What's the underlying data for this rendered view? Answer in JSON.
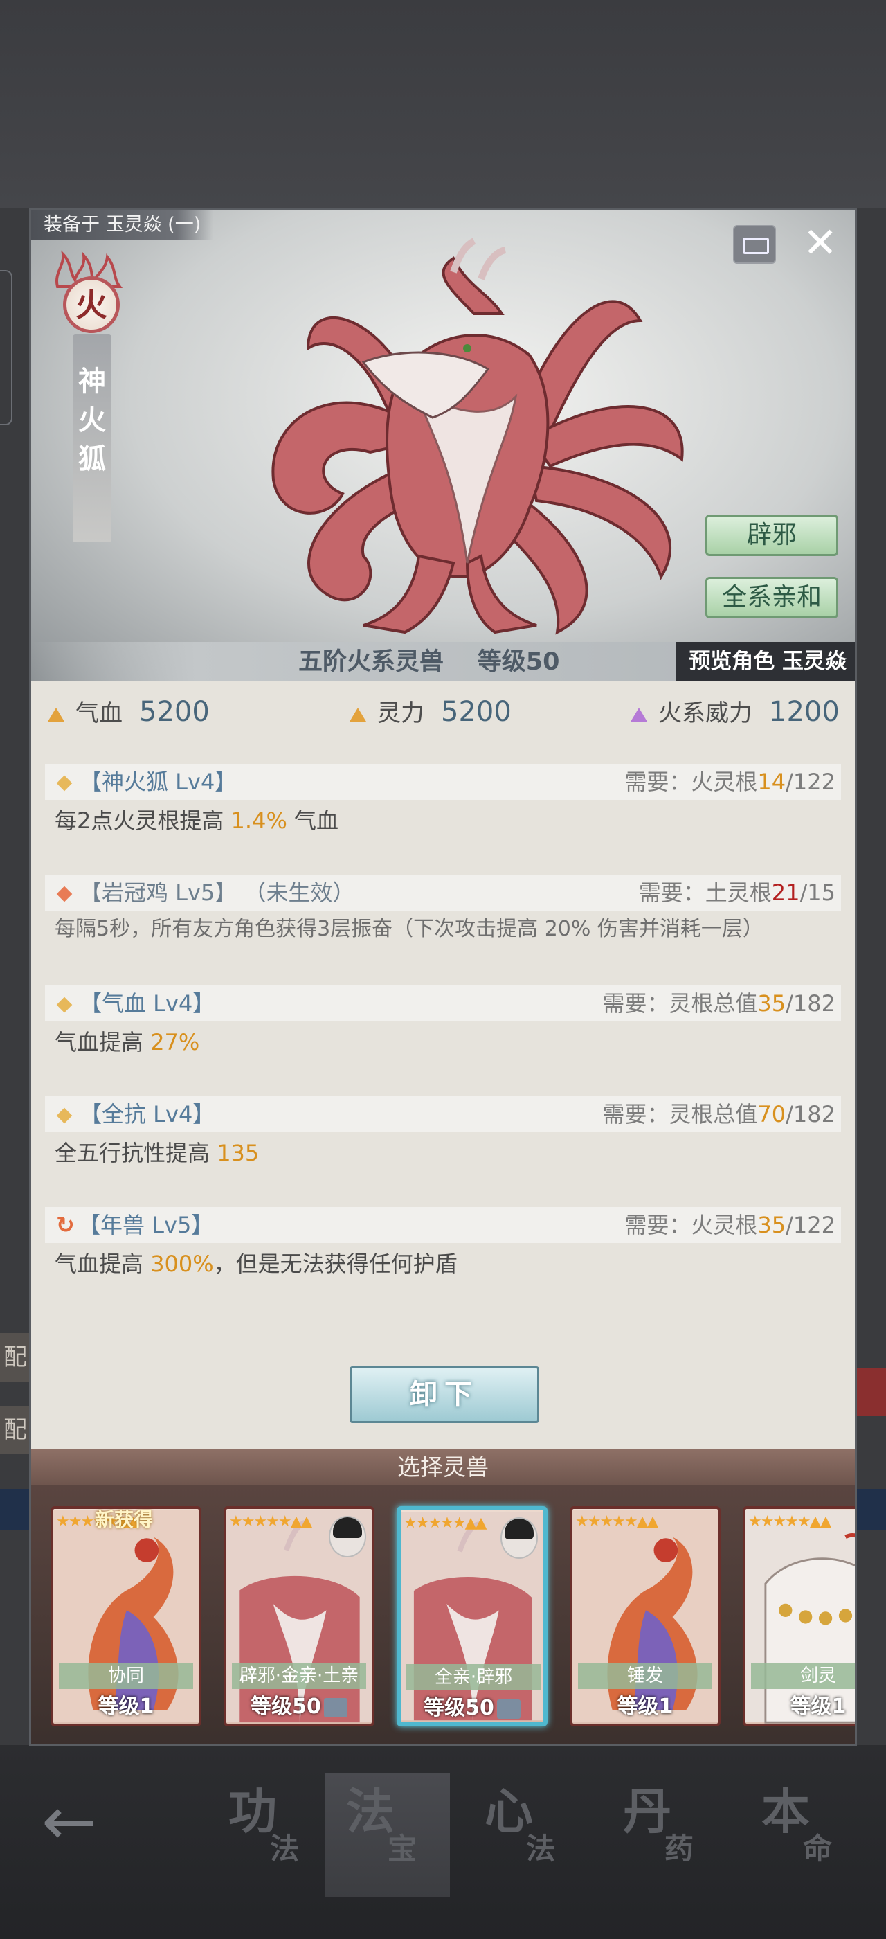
{
  "window": {
    "equipped_on": "装备于 玉灵焱 (一)"
  },
  "beast": {
    "element_badge": "火",
    "name": "神火狐",
    "tags": [
      "辟邪",
      "全系亲和"
    ],
    "tier_text": "五阶火系灵兽",
    "level_text": "等级50",
    "preview": "预览角色 玉灵焱"
  },
  "stats": [
    {
      "label": "气血",
      "value": "5200"
    },
    {
      "label": "灵力",
      "value": "5200"
    },
    {
      "label": "火系威力",
      "value": "1200"
    }
  ],
  "skills": [
    {
      "title": "【神火狐 Lv4】",
      "status": "",
      "req_label": "需要：火灵根",
      "req_have": "14",
      "req_total": "/122",
      "desc_a": "每2点火灵根提高 ",
      "desc_hl": "1.4%",
      "desc_b": " 气血"
    },
    {
      "title": "【岩冠鸡 Lv5】",
      "status": "（未生效）",
      "req_label": "需要：土灵根",
      "req_have": "21",
      "req_total": "/15",
      "desc_a": "每隔5秒，所有友方角色获得3层振奋（下次攻击提高 20% 伤害并消耗一层）",
      "desc_hl": "",
      "desc_b": ""
    },
    {
      "title": "【气血 Lv4】",
      "status": "",
      "req_label": "需要：灵根总值",
      "req_have": "35",
      "req_total": "/182",
      "desc_a": "气血提高 ",
      "desc_hl": "27%",
      "desc_b": ""
    },
    {
      "title": "【全抗 Lv4】",
      "status": "",
      "req_label": "需要：灵根总值",
      "req_have": "70",
      "req_total": "/182",
      "desc_a": "全五行抗性提高 ",
      "desc_hl": "135",
      "desc_b": ""
    },
    {
      "title": "【年兽 Lv5】",
      "status": "",
      "req_label": "需要：火灵根",
      "req_have": "35",
      "req_total": "/122",
      "desc_a": "气血提高 ",
      "desc_hl": "300%",
      "desc_b": "，但是无法获得任何护盾"
    }
  ],
  "unequip_label": "卸下",
  "select_title": "选择灵兽",
  "cards": [
    {
      "new": "新获得",
      "tag": "协同",
      "level": "等级1",
      "kind": "phoenix"
    },
    {
      "new": "",
      "tag": "辟邪·金亲·土亲",
      "level": "等级50",
      "kind": "fox"
    },
    {
      "new": "",
      "tag": "全亲·辟邪",
      "level": "等级50",
      "kind": "fox"
    },
    {
      "new": "",
      "tag": "锤发",
      "level": "等级1",
      "kind": "phoenix"
    },
    {
      "new": "",
      "tag": "剑灵",
      "level": "等级1",
      "kind": "white"
    }
  ],
  "bg_strip_chars": [
    "配",
    "配"
  ],
  "nav": {
    "items": [
      {
        "big": "功",
        "small": "法"
      },
      {
        "big": "法",
        "small": "宝"
      },
      {
        "big": "心",
        "small": "法"
      },
      {
        "big": "丹",
        "small": "药"
      },
      {
        "big": "本",
        "small": "命"
      }
    ]
  }
}
